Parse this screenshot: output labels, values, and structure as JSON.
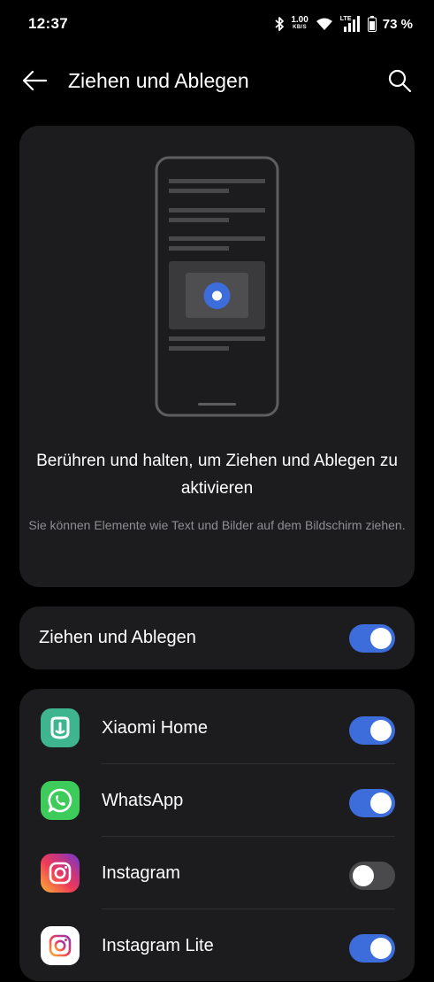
{
  "status_bar": {
    "time": "12:37",
    "net_speed_value": "1.00",
    "net_speed_unit": "KB/S",
    "network_type": "LTE",
    "battery": "73 %"
  },
  "header": {
    "title": "Ziehen und Ablegen",
    "back_icon": "arrow-left-icon",
    "search_icon": "search-icon"
  },
  "illustration": {
    "title": "Berühren und halten, um Ziehen und Ablegen zu aktivieren",
    "description": "Sie können Elemente wie Text und Bilder auf dem Bildschirm ziehen."
  },
  "main_toggle": {
    "label": "Ziehen und Ablegen",
    "enabled": true
  },
  "apps": [
    {
      "name": "Xiaomi Home",
      "enabled": true,
      "icon": "xiaomi-home-icon"
    },
    {
      "name": "WhatsApp",
      "enabled": true,
      "icon": "whatsapp-icon"
    },
    {
      "name": "Instagram",
      "enabled": false,
      "icon": "instagram-icon"
    },
    {
      "name": "Instagram Lite",
      "enabled": true,
      "icon": "instagram-lite-icon"
    }
  ],
  "colors": {
    "background": "#000000",
    "card": "#1c1c1e",
    "accent": "#3d6cdb",
    "toggle_off": "#4a4a4d",
    "secondary_text": "#8e8e93"
  }
}
